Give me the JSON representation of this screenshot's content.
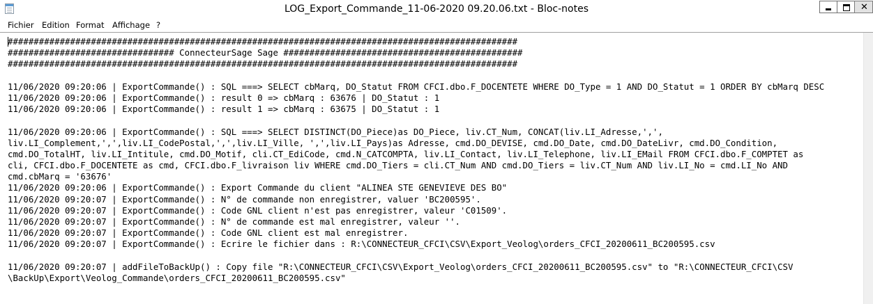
{
  "window": {
    "title": "LOG_Export_Commande_11-06-2020 09.20.06.txt - Bloc-notes",
    "close_glyph": "✕"
  },
  "menu": [
    "Fichier",
    "Edition",
    "Format",
    "Affichage",
    "?"
  ],
  "lines": [
    "##################################################################################################",
    "################################ ConnecteurSage Sage ##############################################",
    "##################################################################################################",
    "",
    "11/06/2020 09:20:06 | ExportCommande() : SQL ===> SELECT cbMarq, DO_Statut FROM CFCI.dbo.F_DOCENTETE WHERE DO_Type = 1 AND DO_Statut = 1 ORDER BY cbMarq DESC",
    "11/06/2020 09:20:06 | ExportCommande() : result 0 => cbMarq : 63676 | DO_Statut : 1",
    "11/06/2020 09:20:06 | ExportCommande() : result 1 => cbMarq : 63675 | DO_Statut : 1",
    "",
    "11/06/2020 09:20:06 | ExportCommande() : SQL ===> SELECT DISTINCT(DO_Piece)as DO_Piece, liv.CT_Num, CONCAT(liv.LI_Adresse,',',",
    "liv.LI_Complement,',',liv.LI_CodePostal,',',liv.LI_Ville, ',',liv.LI_Pays)as Adresse, cmd.DO_DEVISE, cmd.DO_Date, cmd.DO_DateLivr, cmd.DO_Condition,",
    "cmd.DO_TotalHT, liv.LI_Intitule, cmd.DO_Motif, cli.CT_EdiCode, cmd.N_CATCOMPTA, liv.LI_Contact, liv.LI_Telephone, liv.LI_EMail FROM CFCI.dbo.F_COMPTET as",
    "cli, CFCI.dbo.F_DOCENTETE as cmd, CFCI.dbo.F_livraison liv WHERE cmd.DO_Tiers = cli.CT_Num AND cmd.DO_Tiers = liv.CT_Num AND liv.LI_No = cmd.LI_No AND",
    "cmd.cbMarq = '63676'",
    "11/06/2020 09:20:06 | ExportCommande() : Export Commande du client \"ALINEA STE GENEVIEVE DES BO\"",
    "11/06/2020 09:20:07 | ExportCommande() : N° de commande non enregistrer, valuer 'BC200595'.",
    "11/06/2020 09:20:07 | ExportCommande() : Code GNL client n'est pas enregistrer, valeur 'C01509'.",
    "11/06/2020 09:20:07 | ExportCommande() : N° de commande est mal enregistrer, valeur ''.",
    "11/06/2020 09:20:07 | ExportCommande() : Code GNL client est mal enregistrer.",
    "11/06/2020 09:20:07 | ExportCommande() : Ecrire le fichier dans : R:\\CONNECTEUR_CFCI\\CSV\\Export_Veolog\\orders_CFCI_20200611_BC200595.csv",
    "",
    "11/06/2020 09:20:07 | addFileToBackUp() : Copy file \"R:\\CONNECTEUR_CFCI\\CSV\\Export_Veolog\\orders_CFCI_20200611_BC200595.csv\" to \"R:\\CONNECTEUR_CFCI\\CSV",
    "\\BackUp\\Export\\Veolog_Commande\\orders_CFCI_20200611_BC200595.csv\""
  ]
}
